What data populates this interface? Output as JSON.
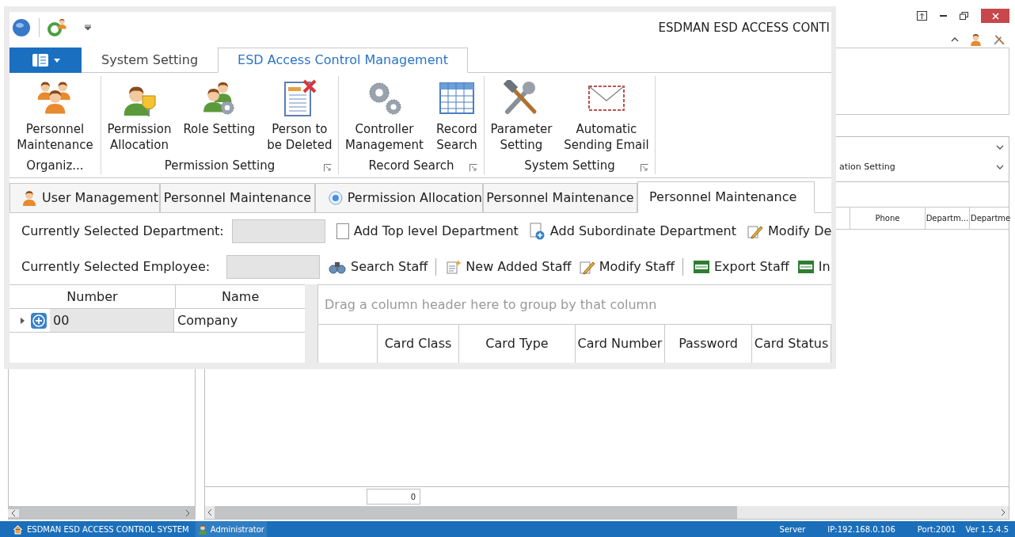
{
  "background_window": {
    "filter_dropdown_value": "ation Setting",
    "grid_columns": [
      "Phone",
      "Departm...",
      "Departme"
    ],
    "footer_count": "0",
    "status_bar": {
      "app_name": "ESDMAN ESD ACCESS CONTROL SYSTEM",
      "user": "Administrator",
      "server": "Server",
      "ip": "IP:192.168.0.106",
      "port": "Port:2001",
      "version": "Ver 1.5.4.5"
    }
  },
  "magnified_view": {
    "title": "ESDMAN ESD ACCESS CONTI",
    "ribbon_tabs": [
      {
        "label": "System Setting",
        "selected": false
      },
      {
        "label": "ESD Access Control Management",
        "selected": true
      }
    ],
    "ribbon_groups": [
      {
        "label": "Organiz...",
        "launcher": false,
        "buttons": [
          {
            "label": "Personnel\nMaintenance"
          }
        ]
      },
      {
        "label": "Permission Setting",
        "launcher": true,
        "buttons": [
          {
            "label": "Permission\nAllocation"
          },
          {
            "label": "Role Setting"
          },
          {
            "label": "Person to\nbe Deleted"
          }
        ]
      },
      {
        "label": "Record Search",
        "launcher": true,
        "buttons": [
          {
            "label": "Controller\nManagement"
          },
          {
            "label": "Record\nSearch"
          }
        ]
      },
      {
        "label": "System Setting",
        "launcher": true,
        "buttons": [
          {
            "label": "Parameter\nSetting"
          },
          {
            "label": "Automatic\nSending Email"
          }
        ]
      }
    ],
    "document_tabs": [
      {
        "label": "User Management",
        "selected": false
      },
      {
        "label": "Personnel Maintenance",
        "selected": false
      },
      {
        "label": "Permission Allocation",
        "selected": false
      },
      {
        "label": "Personnel Maintenance",
        "selected": false
      },
      {
        "label": "Personnel Maintenance",
        "selected": true
      }
    ],
    "department_row": {
      "label": "Currently Selected Department:",
      "actions": [
        {
          "label": "Add Top level Department"
        },
        {
          "label": "Add Subordinate Department"
        },
        {
          "label": "Modify De"
        }
      ]
    },
    "employee_row": {
      "label": "Currently Selected Employee:",
      "action_groups": [
        [
          {
            "label": "Search Staff"
          }
        ],
        [
          {
            "label": "New Added Staff"
          },
          {
            "label": "Modify Staff"
          }
        ],
        [
          {
            "label": "Export Staff"
          },
          {
            "label": "In"
          }
        ]
      ]
    },
    "tree_grid": {
      "columns": [
        "Number",
        "Name"
      ],
      "rows": [
        {
          "number": "00",
          "name": "Company",
          "expanded": false
        }
      ]
    },
    "card_grid": {
      "group_panel_hint": "Drag a column header here to group by that column",
      "columns": [
        "Card Class",
        "Card Type",
        "Card Number",
        "Password",
        "Card Status"
      ]
    }
  }
}
